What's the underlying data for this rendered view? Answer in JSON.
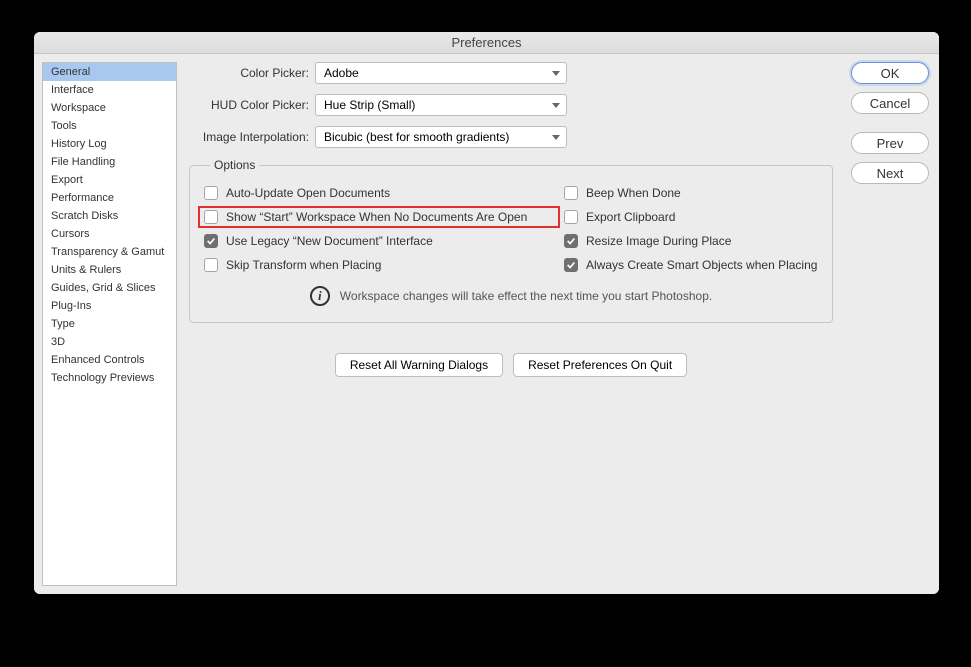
{
  "title": "Preferences",
  "sidebar": {
    "items": [
      "General",
      "Interface",
      "Workspace",
      "Tools",
      "History Log",
      "File Handling",
      "Export",
      "Performance",
      "Scratch Disks",
      "Cursors",
      "Transparency & Gamut",
      "Units & Rulers",
      "Guides, Grid & Slices",
      "Plug-Ins",
      "Type",
      "3D",
      "Enhanced Controls",
      "Technology Previews"
    ],
    "selected_index": 0
  },
  "form": {
    "color_picker_label": "Color Picker:",
    "color_picker_value": "Adobe",
    "hud_color_picker_label": "HUD Color Picker:",
    "hud_color_picker_value": "Hue Strip (Small)",
    "interpolation_label": "Image Interpolation:",
    "interpolation_value": "Bicubic (best for smooth gradients)"
  },
  "options": {
    "legend": "Options",
    "left": [
      {
        "label": "Auto-Update Open Documents",
        "checked": false,
        "highlight": false
      },
      {
        "label": "Show “Start” Workspace When No Documents Are Open",
        "checked": false,
        "highlight": true
      },
      {
        "label": "Use Legacy “New Document” Interface",
        "checked": true,
        "highlight": false
      },
      {
        "label": "Skip Transform when Placing",
        "checked": false,
        "highlight": false
      }
    ],
    "right": [
      {
        "label": "Beep When Done",
        "checked": false
      },
      {
        "label": "Export Clipboard",
        "checked": false
      },
      {
        "label": "Resize Image During Place",
        "checked": true
      },
      {
        "label": "Always Create Smart Objects when Placing",
        "checked": true
      }
    ],
    "note": "Workspace changes will take effect the next time you start Photoshop."
  },
  "reset": {
    "warnings": "Reset All Warning Dialogs",
    "prefs": "Reset Preferences On Quit"
  },
  "buttons": {
    "ok": "OK",
    "cancel": "Cancel",
    "prev": "Prev",
    "next": "Next"
  }
}
